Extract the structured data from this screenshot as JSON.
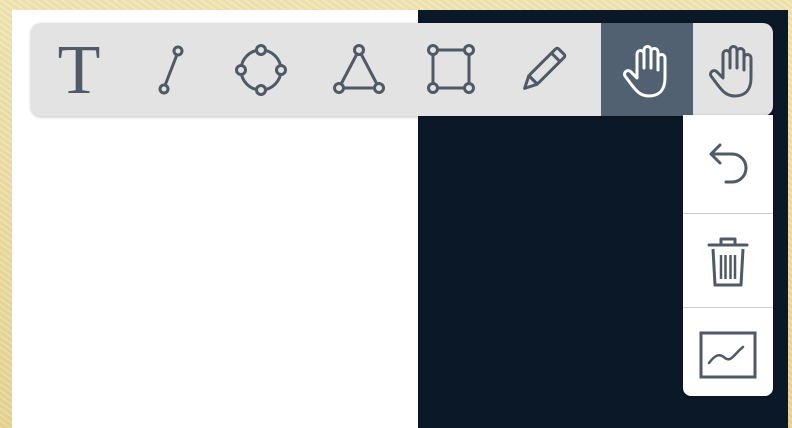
{
  "toolbar": {
    "tools": [
      {
        "id": "text",
        "label": "T",
        "icon": "text-icon",
        "active": false
      },
      {
        "id": "line",
        "icon": "line-icon",
        "active": false
      },
      {
        "id": "circle",
        "icon": "circle-icon",
        "active": false
      },
      {
        "id": "triangle",
        "icon": "triangle-icon",
        "active": false
      },
      {
        "id": "rectangle",
        "icon": "rectangle-icon",
        "active": false
      },
      {
        "id": "pencil",
        "icon": "pencil-icon",
        "active": false
      },
      {
        "id": "pan",
        "icon": "hand-icon",
        "active": true
      },
      {
        "id": "pan-menu",
        "icon": "hand-icon",
        "active": false
      }
    ]
  },
  "side_panel": {
    "buttons": [
      {
        "id": "undo",
        "icon": "undo-icon"
      },
      {
        "id": "clear",
        "icon": "trash-icon"
      },
      {
        "id": "chart",
        "icon": "chart-icon"
      }
    ]
  },
  "colors": {
    "toolbar_bg": "#e3e3e3",
    "active_tool_bg": "#526171",
    "icon": "#4f5a66",
    "canvas_dark": "#0b1827",
    "canvas_light": "#ffffff"
  }
}
